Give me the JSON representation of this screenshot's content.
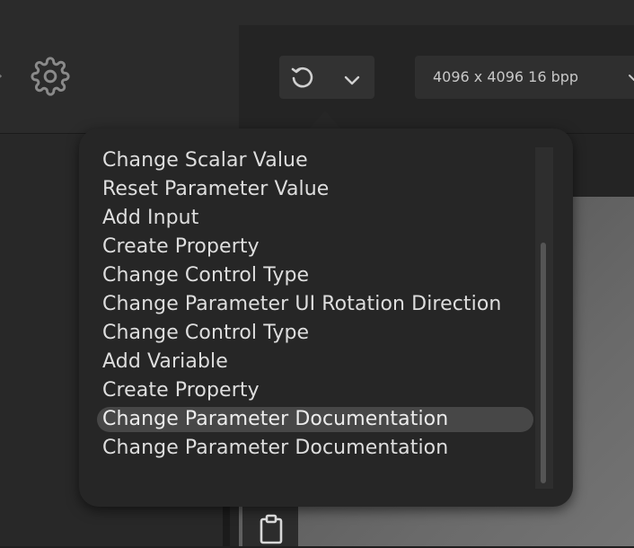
{
  "toolbar": {
    "settings_icon": "gear-icon",
    "undo_icon": "undo-icon",
    "history_dropdown_icon": "chevron-down-icon",
    "resolution": "4096 x 4096 16 bpp"
  },
  "history_menu": {
    "items": [
      "Change Scalar Value",
      "Reset Parameter Value",
      "Add Input",
      "Create Property",
      "Change Control Type",
      "Change Parameter UI Rotation Direction",
      "Change Control Type",
      "Add Variable",
      "Create Property",
      "Change Parameter Documentation",
      "Change Parameter Documentation"
    ],
    "highlighted_index": 9
  },
  "side_panel": {
    "clipboard_icon": "clipboard-icon"
  },
  "colors": {
    "menu_background": "#262626",
    "menu_text": "#dedede",
    "highlight": "#474747"
  }
}
